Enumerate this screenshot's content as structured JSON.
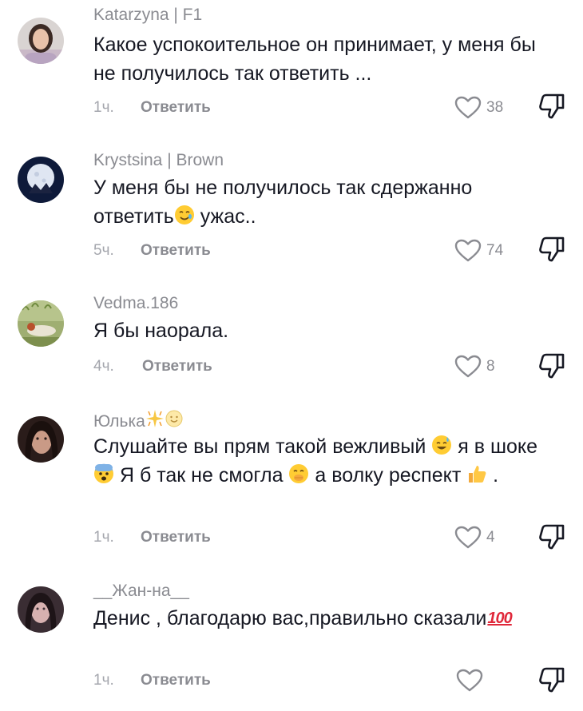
{
  "comments": [
    {
      "username": "Katarzyna | F1",
      "text": "Какое успокоительное он принимает, у меня бы не получилось так ответить ...",
      "time": "1ч.",
      "reply_label": "Ответить",
      "likes": "38",
      "avatar": "woman-portrait-avatar"
    },
    {
      "username": "Krystsina | Brown",
      "text_parts": [
        "У меня бы не получилось так сдержанно ответить",
        "ужас.."
      ],
      "emoji": [
        "crying-smile-emoji"
      ],
      "time": "5ч.",
      "reply_label": "Ответить",
      "likes": "74",
      "avatar": "moon-night-avatar"
    },
    {
      "username": "Vedma.186",
      "text": "Я бы наорала.",
      "time": "4ч.",
      "reply_label": "Ответить",
      "likes": "8",
      "avatar": "painting-woman-avatar"
    },
    {
      "username": "Юлька",
      "username_emoji": [
        "sparkle-emoji",
        "smile-emoji"
      ],
      "text_parts": [
        "Слушайте вы прям такой вежливый",
        "я в шоке",
        "Я б так не смогла",
        "а волку респект",
        "."
      ],
      "emoji": [
        "sweat-smile-emoji",
        "fearful-face-emoji",
        "hand-over-mouth-emoji",
        "thumbs-up-emoji"
      ],
      "time": "1ч.",
      "reply_label": "Ответить",
      "likes": "4",
      "avatar": "dark-hair-woman-avatar"
    },
    {
      "username": "__Жан-на__",
      "text": "Денис , благодарю вас,правильно сказали",
      "text_emoji": "100",
      "time": "1ч.",
      "reply_label": "Ответить",
      "likes": "",
      "avatar": "dark-portrait-avatar"
    }
  ],
  "colors": {
    "text": "#161823",
    "secondary": "#8a8b91",
    "time": "#a4a6ad",
    "hundred": "#e0283a"
  }
}
